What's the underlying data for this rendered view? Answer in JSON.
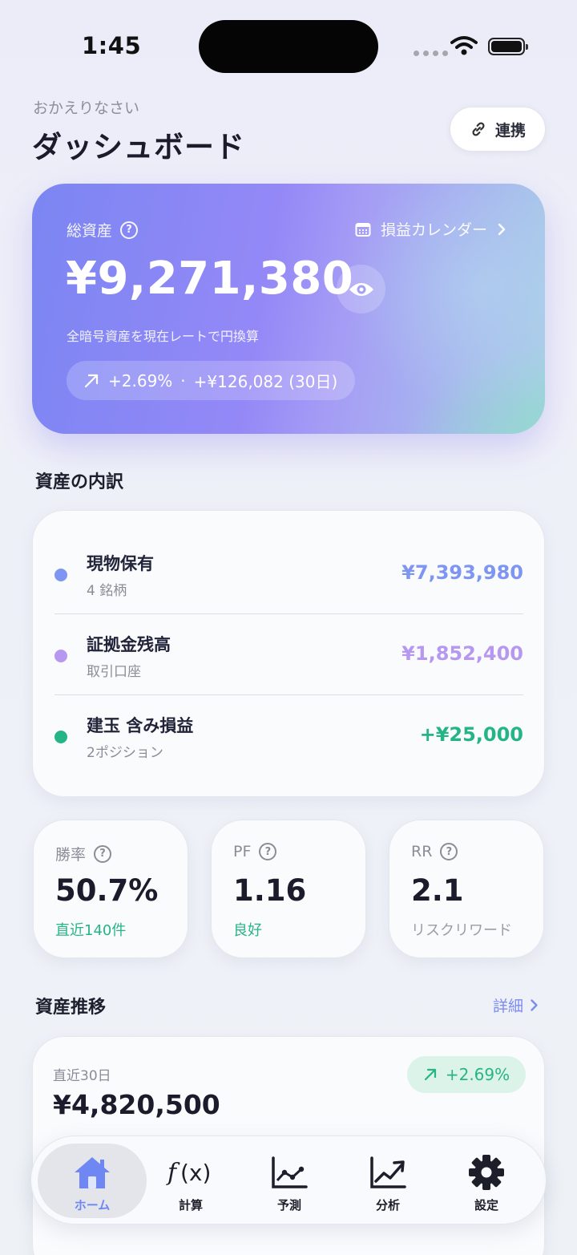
{
  "status_bar": {
    "time": "1:45"
  },
  "header": {
    "greeting": "おかえりなさい",
    "title": "ダッシュボード",
    "link_button_label": "連携",
    "link_icon": "link-icon"
  },
  "total_assets": {
    "label": "総資産",
    "calendar_label": "損益カレンダー",
    "amount": "¥9,271,380",
    "subtitle": "全暗号資産を現在レートで円換算",
    "change_pct": "+2.69%",
    "separator": "·",
    "change_amount": "+¥126,082 (30日)"
  },
  "breakdown": {
    "title": "資産の内訳",
    "items": [
      {
        "name": "現物保有",
        "desc": "4 銘柄",
        "value": "¥7,393,980",
        "color": "#7e95f2"
      },
      {
        "name": "証拠金残高",
        "desc": "取引口座",
        "value": "¥1,852,400",
        "color": "#b698f0"
      },
      {
        "name": "建玉 含み損益",
        "desc": "2ポジション",
        "value": "+¥25,000",
        "color": "#25b585"
      }
    ]
  },
  "metrics": [
    {
      "label": "勝率",
      "value": "50.7%",
      "sub": "直近140件",
      "sub_color": "#27b584"
    },
    {
      "label": "PF",
      "value": "1.16",
      "sub": "良好",
      "sub_color": "#27b584"
    },
    {
      "label": "RR",
      "value": "2.1",
      "sub": "リスクリワード",
      "sub_color": "#9a9ca6"
    }
  ],
  "trend": {
    "title": "資産推移",
    "detail_label": "詳細",
    "period": "直近30日",
    "value": "¥4,820,500",
    "change_pct": "+2.69%"
  },
  "tabbar": {
    "items": [
      {
        "label": "ホーム",
        "icon": "home-icon",
        "active": true
      },
      {
        "label": "計算",
        "icon": "function-icon",
        "active": false
      },
      {
        "label": "予測",
        "icon": "forecast-chart-icon",
        "active": false
      },
      {
        "label": "分析",
        "icon": "analysis-chart-icon",
        "active": false
      },
      {
        "label": "設定",
        "icon": "gear-icon",
        "active": false
      }
    ]
  },
  "colors": {
    "accent": "#7d8bf0",
    "positive": "#27b584",
    "hero_start": "#7b86f2",
    "hero_end": "#8fd6cf"
  }
}
